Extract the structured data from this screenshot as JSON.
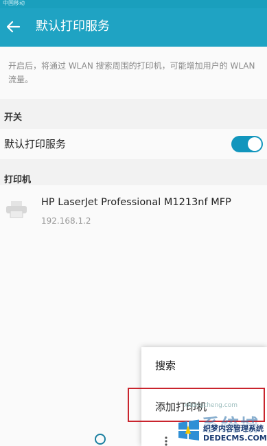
{
  "status_bar": {
    "operator": "中国移动"
  },
  "header": {
    "title": "默认打印服务",
    "back_icon": "arrow-left-icon"
  },
  "description": "开启后，将通过 WLAN 搜索周围的打印机，可能增加用户的 WLAN 流量。",
  "switch_section": {
    "label": "开关",
    "item_label": "默认打印服务",
    "enabled": true
  },
  "printers_section": {
    "label": "打印机",
    "printers": [
      {
        "name": "HP LaserJet Professional M1213nf MFP",
        "ip": "192.168.1.2",
        "icon": "printer-icon"
      }
    ]
  },
  "overflow_menu": {
    "items": [
      "搜索",
      "添加打印机"
    ],
    "highlighted": "添加打印机"
  },
  "watermark": {
    "big": "系统城",
    "line1": "织梦内容管理系统",
    "line2": "DEDECMS.COM",
    "site": "xitongcheng.com"
  },
  "colors": {
    "accent": "#1fa3c3",
    "toggle": "#1296bd",
    "highlight_border": "#c9242d"
  }
}
